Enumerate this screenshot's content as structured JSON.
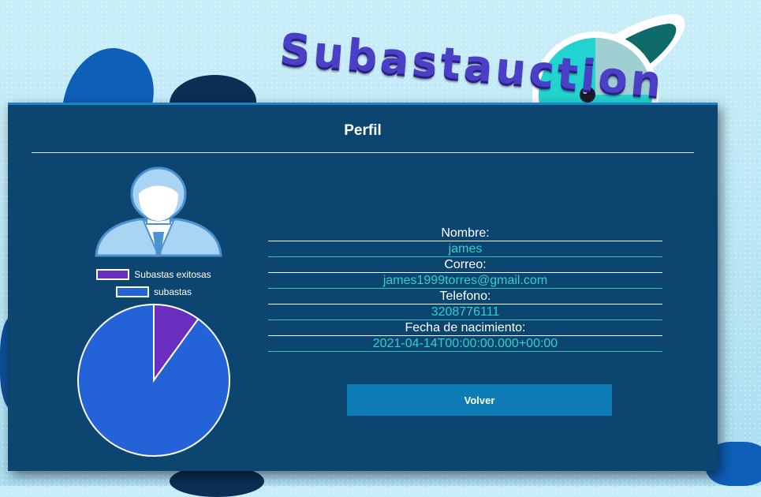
{
  "logo": {
    "text": "Subastauction"
  },
  "card": {
    "title": "Perfil"
  },
  "legend": {
    "items": [
      {
        "label": "Subastas exitosas",
        "color": "#6a2fc0"
      },
      {
        "label": "subastas",
        "color": "#2462d8"
      }
    ]
  },
  "chart_data": {
    "type": "pie",
    "labels": [
      "Subastas exitosas",
      "subastas"
    ],
    "values": [
      1,
      9
    ],
    "colors": [
      "#6a2fc0",
      "#2462d8"
    ]
  },
  "profile": {
    "nombre_label": "Nombre:",
    "nombre_value": "james",
    "correo_label": "Correo:",
    "correo_value": "james1999torres@gmail.com",
    "telefono_label": "Telefono:",
    "telefono_value": "3208776111",
    "fecha_label": "Fecha de nacimiento:",
    "fecha_value": "2021-04-14T00:00:00.000+00:00"
  },
  "actions": {
    "volver_label": "Volver"
  }
}
